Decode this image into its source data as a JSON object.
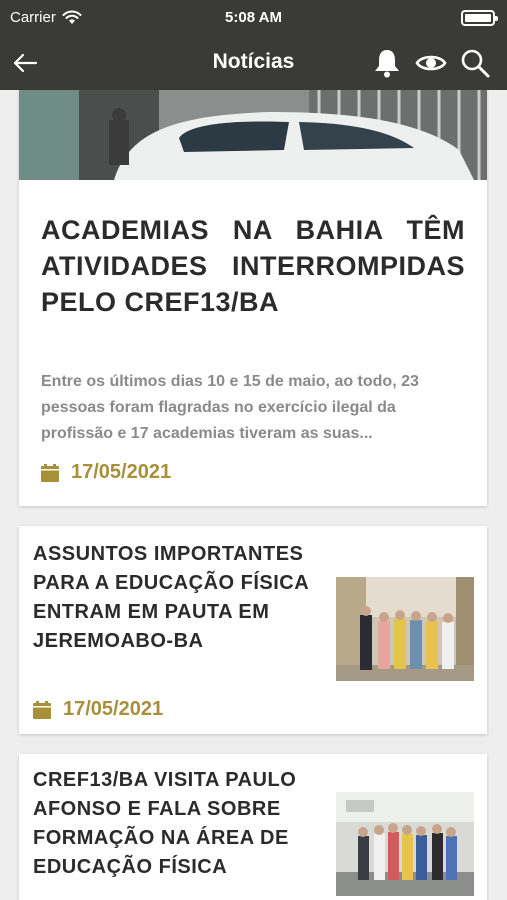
{
  "status_bar": {
    "carrier": "Carrier",
    "time": "5:08 AM",
    "icons": [
      "wifi-icon",
      "battery-icon"
    ]
  },
  "nav": {
    "title": "Notícias",
    "icons": [
      "back-arrow-icon",
      "bell-icon",
      "eye-icon",
      "search-icon"
    ]
  },
  "colors": {
    "bar_background": "#3a3a37",
    "accent_gold": "#a88f3a",
    "title_text": "#2b2b2b",
    "body_gray": "#8a8a8a",
    "page_background": "#eeeeee"
  },
  "news": [
    {
      "title": "ACADEMIAS NA BAHIA TÊM ATIVIDADES INTERROMPIDAS PELO CREF13/BA",
      "summary": "Entre os últimos dias 10 e 15 de maio, ao todo, 23 pessoas foram flagradas no exercício ilegal da profissão e 17 academias tiveram as suas...",
      "date": "17/05/2021",
      "date_icon": "calendar-icon",
      "image": "street-car-photo"
    },
    {
      "title": "ASSUNTOS IMPORTANTES PARA A EDUCAÇÃO FÍSICA ENTRAM EM PAUTA EM JEREMOABO-BA",
      "date": "17/05/2021",
      "date_icon": "calendar-icon",
      "image": "group-meeting-photo"
    },
    {
      "title": "CREF13/BA VISITA PAULO AFONSO E FALA SOBRE FORMAÇÃO NA ÁREA DE EDUCAÇÃO FÍSICA",
      "image": "group-visit-photo"
    }
  ]
}
